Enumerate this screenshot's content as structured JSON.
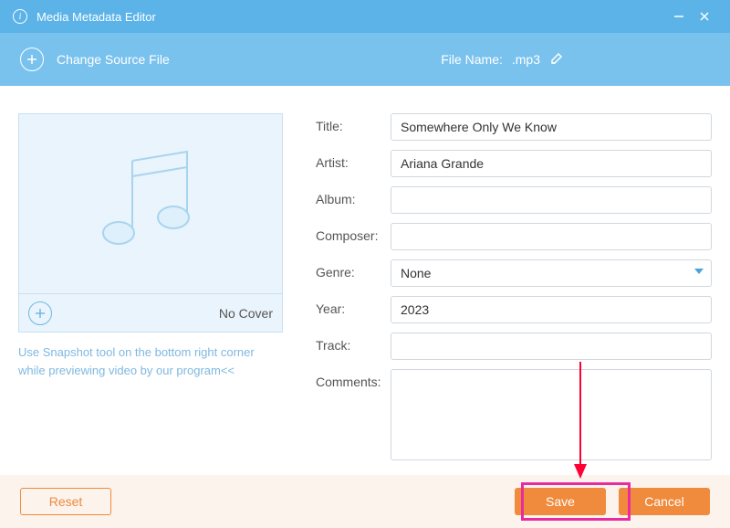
{
  "titlebar": {
    "title": "Media Metadata Editor"
  },
  "toolbar": {
    "change_source": "Change Source File",
    "file_name_label": "File Name:",
    "file_name_value": ".mp3"
  },
  "cover": {
    "no_cover_label": "No Cover",
    "hint": "Use Snapshot tool on the bottom right corner while previewing video by our program<<"
  },
  "form": {
    "labels": {
      "title": "Title:",
      "artist": "Artist:",
      "album": "Album:",
      "composer": "Composer:",
      "genre": "Genre:",
      "year": "Year:",
      "track": "Track:",
      "comments": "Comments:"
    },
    "values": {
      "title": "Somewhere Only We Know",
      "artist": "Ariana Grande",
      "album": "",
      "composer": "",
      "genre": "None",
      "year": "2023",
      "track": "",
      "comments": ""
    }
  },
  "footer": {
    "reset": "Reset",
    "save": "Save",
    "cancel": "Cancel"
  }
}
